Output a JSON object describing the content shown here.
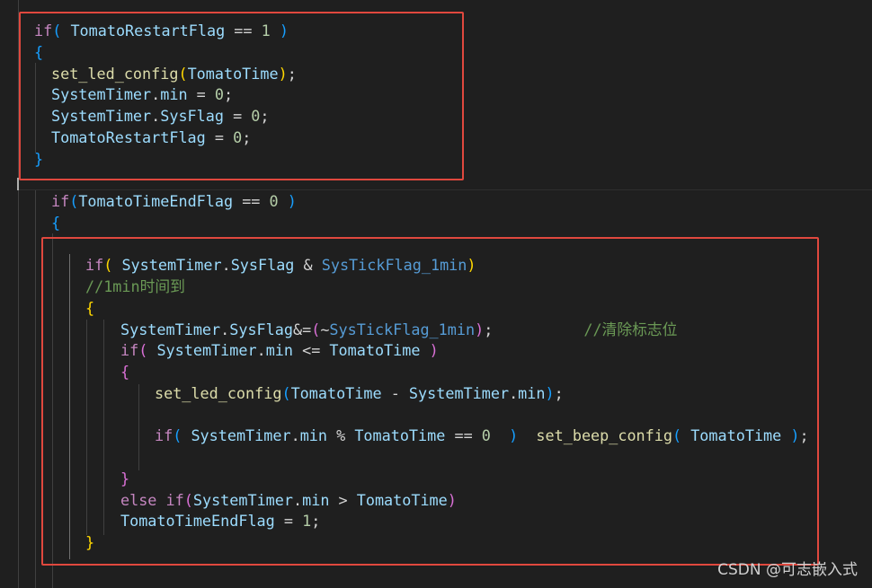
{
  "colors": {
    "background": "#1f1f1f",
    "keyword": "#c586c0",
    "identifier": "#9cdcfe",
    "function": "#dcdcaa",
    "number": "#b5cea8",
    "macro": "#569cd6",
    "operator": "#d4d4d4",
    "comment": "#6a9955",
    "bracket_level1": "#ffd700",
    "bracket_level2": "#da70d6",
    "bracket_level3": "#179fff",
    "highlight_box": "#e0483e"
  },
  "code": {
    "lines": [
      {
        "id": "l1",
        "tokens": [
          {
            "t": "if",
            "c": "kw"
          },
          {
            "t": "( ",
            "c": "b3"
          },
          {
            "t": "TomatoRestartFlag",
            "c": "id"
          },
          {
            "t": " == ",
            "c": "op"
          },
          {
            "t": "1",
            "c": "num"
          },
          {
            "t": " )",
            "c": "b3"
          }
        ]
      },
      {
        "id": "l2",
        "tokens": [
          {
            "t": "{",
            "c": "b3"
          }
        ]
      },
      {
        "id": "l3",
        "tokens": [
          {
            "t": "set_led_config",
            "c": "fn"
          },
          {
            "t": "(",
            "c": "b1"
          },
          {
            "t": "TomatoTime",
            "c": "id"
          },
          {
            "t": ")",
            "c": "b1"
          },
          {
            "t": ";",
            "c": "op"
          }
        ]
      },
      {
        "id": "l4",
        "tokens": [
          {
            "t": "SystemTimer",
            "c": "id"
          },
          {
            "t": ".",
            "c": "op"
          },
          {
            "t": "min",
            "c": "id"
          },
          {
            "t": " = ",
            "c": "op"
          },
          {
            "t": "0",
            "c": "num"
          },
          {
            "t": ";",
            "c": "op"
          }
        ]
      },
      {
        "id": "l5",
        "tokens": [
          {
            "t": "SystemTimer",
            "c": "id"
          },
          {
            "t": ".",
            "c": "op"
          },
          {
            "t": "SysFlag",
            "c": "id"
          },
          {
            "t": " = ",
            "c": "op"
          },
          {
            "t": "0",
            "c": "num"
          },
          {
            "t": ";",
            "c": "op"
          }
        ]
      },
      {
        "id": "l6",
        "tokens": [
          {
            "t": "TomatoRestartFlag",
            "c": "id"
          },
          {
            "t": " = ",
            "c": "op"
          },
          {
            "t": "0",
            "c": "num"
          },
          {
            "t": ";",
            "c": "op"
          }
        ]
      },
      {
        "id": "l7",
        "tokens": [
          {
            "t": "}",
            "c": "b3"
          }
        ]
      },
      {
        "id": "l8",
        "tokens": [
          {
            "t": "if",
            "c": "kw"
          },
          {
            "t": "(",
            "c": "b3"
          },
          {
            "t": "TomatoTimeEndFlag",
            "c": "id"
          },
          {
            "t": " == ",
            "c": "op"
          },
          {
            "t": "0",
            "c": "num"
          },
          {
            "t": " )",
            "c": "b3"
          }
        ]
      },
      {
        "id": "l9",
        "tokens": [
          {
            "t": "{",
            "c": "b3"
          }
        ]
      },
      {
        "id": "l10",
        "tokens": [
          {
            "t": "if",
            "c": "kw"
          },
          {
            "t": "( ",
            "c": "b1"
          },
          {
            "t": "SystemTimer",
            "c": "id"
          },
          {
            "t": ".",
            "c": "op"
          },
          {
            "t": "SysFlag",
            "c": "id"
          },
          {
            "t": " & ",
            "c": "op"
          },
          {
            "t": "SysTickFlag_1min",
            "c": "mac"
          },
          {
            "t": ")",
            "c": "b1"
          }
        ]
      },
      {
        "id": "l11",
        "tokens": [
          {
            "t": "//1min时间到",
            "c": "cm"
          }
        ]
      },
      {
        "id": "l12",
        "tokens": [
          {
            "t": "{",
            "c": "b1"
          }
        ]
      },
      {
        "id": "l13",
        "tokens": [
          {
            "t": "SystemTimer",
            "c": "id"
          },
          {
            "t": ".",
            "c": "op"
          },
          {
            "t": "SysFlag",
            "c": "id"
          },
          {
            "t": "&=",
            "c": "op"
          },
          {
            "t": "(",
            "c": "b2"
          },
          {
            "t": "~",
            "c": "op"
          },
          {
            "t": "SysTickFlag_1min",
            "c": "mac"
          },
          {
            "t": ")",
            "c": "b2"
          },
          {
            "t": ";",
            "c": "op"
          },
          {
            "t": "          ",
            "c": "op"
          },
          {
            "t": "//清除标志位",
            "c": "cm"
          }
        ]
      },
      {
        "id": "l14",
        "tokens": [
          {
            "t": "if",
            "c": "kw"
          },
          {
            "t": "( ",
            "c": "b2"
          },
          {
            "t": "SystemTimer",
            "c": "id"
          },
          {
            "t": ".",
            "c": "op"
          },
          {
            "t": "min",
            "c": "id"
          },
          {
            "t": " <= ",
            "c": "op"
          },
          {
            "t": "TomatoTime",
            "c": "id"
          },
          {
            "t": " )",
            "c": "b2"
          }
        ]
      },
      {
        "id": "l15",
        "tokens": [
          {
            "t": "{",
            "c": "b2"
          }
        ]
      },
      {
        "id": "l16",
        "tokens": [
          {
            "t": "set_led_config",
            "c": "fn"
          },
          {
            "t": "(",
            "c": "b3"
          },
          {
            "t": "TomatoTime",
            "c": "id"
          },
          {
            "t": " - ",
            "c": "op"
          },
          {
            "t": "SystemTimer",
            "c": "id"
          },
          {
            "t": ".",
            "c": "op"
          },
          {
            "t": "min",
            "c": "id"
          },
          {
            "t": ")",
            "c": "b3"
          },
          {
            "t": ";",
            "c": "op"
          }
        ]
      },
      {
        "id": "l17",
        "tokens": [
          {
            "t": "if",
            "c": "kw"
          },
          {
            "t": "( ",
            "c": "b3"
          },
          {
            "t": "SystemTimer",
            "c": "id"
          },
          {
            "t": ".",
            "c": "op"
          },
          {
            "t": "min",
            "c": "id"
          },
          {
            "t": " % ",
            "c": "op"
          },
          {
            "t": "TomatoTime",
            "c": "id"
          },
          {
            "t": " == ",
            "c": "op"
          },
          {
            "t": "0",
            "c": "num"
          },
          {
            "t": "  )",
            "c": "b3"
          },
          {
            "t": "  ",
            "c": "op"
          },
          {
            "t": "set_beep_config",
            "c": "fn"
          },
          {
            "t": "( ",
            "c": "b3"
          },
          {
            "t": "TomatoTime",
            "c": "id"
          },
          {
            "t": " )",
            "c": "b3"
          },
          {
            "t": ";",
            "c": "op"
          }
        ]
      },
      {
        "id": "l18",
        "tokens": [
          {
            "t": "}",
            "c": "b2"
          }
        ]
      },
      {
        "id": "l19",
        "tokens": [
          {
            "t": "else ",
            "c": "kw"
          },
          {
            "t": "if",
            "c": "kw"
          },
          {
            "t": "(",
            "c": "b2"
          },
          {
            "t": "SystemTimer",
            "c": "id"
          },
          {
            "t": ".",
            "c": "op"
          },
          {
            "t": "min",
            "c": "id"
          },
          {
            "t": " > ",
            "c": "op"
          },
          {
            "t": "TomatoTime",
            "c": "id"
          },
          {
            "t": ")",
            "c": "b2"
          }
        ]
      },
      {
        "id": "l20",
        "tokens": [
          {
            "t": "TomatoTimeEndFlag",
            "c": "id"
          },
          {
            "t": " = ",
            "c": "op"
          },
          {
            "t": "1",
            "c": "num"
          },
          {
            "t": ";",
            "c": "op"
          }
        ]
      },
      {
        "id": "l21",
        "tokens": [
          {
            "t": "}",
            "c": "b1"
          }
        ]
      }
    ]
  },
  "watermark": "CSDN @可志嵌入式"
}
